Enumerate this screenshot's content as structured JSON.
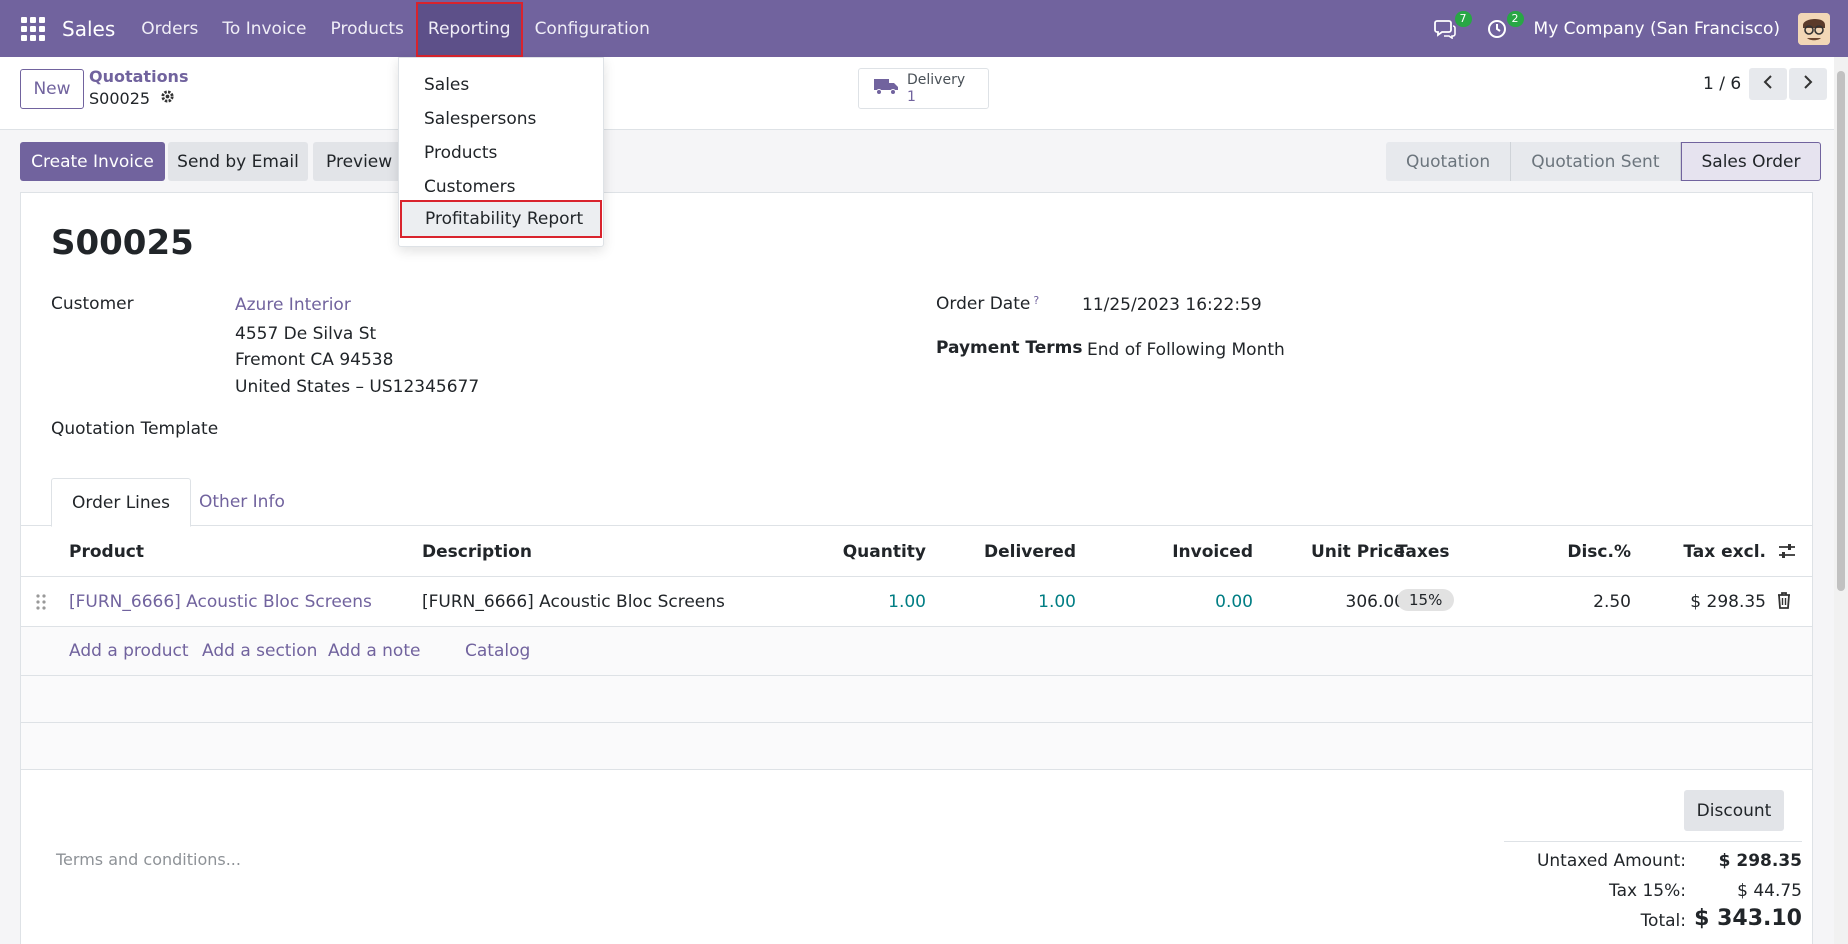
{
  "navbar": {
    "app_name": "Sales",
    "menu": [
      "Orders",
      "To Invoice",
      "Products",
      "Reporting",
      "Configuration"
    ],
    "messages_count": "7",
    "activities_count": "2",
    "company": "My Company (San Francisco)"
  },
  "reporting_menu": {
    "items": [
      "Sales",
      "Salespersons",
      "Products",
      "Customers",
      "Profitability Report"
    ]
  },
  "control_panel": {
    "new_label": "New",
    "breadcrumb_parent": "Quotations",
    "breadcrumb_current": "S00025",
    "delivery_label": "Delivery",
    "delivery_count": "1",
    "pager": "1 / 6"
  },
  "actions": {
    "create_invoice": "Create Invoice",
    "send_email": "Send by Email",
    "preview": "Preview"
  },
  "statusbar": {
    "stages": [
      "Quotation",
      "Quotation Sent",
      "Sales Order"
    ],
    "current": "Sales Order"
  },
  "form": {
    "title": "S00025",
    "customer_label": "Customer",
    "customer_name": "Azure Interior",
    "address_line1": "4557 De Silva St",
    "address_line2": "Fremont CA 94538",
    "address_line3": "United States – US12345677",
    "quotation_template_label": "Quotation Template",
    "order_date_label": "Order Date",
    "order_date_help": "?",
    "order_date": "11/25/2023 16:22:59",
    "payment_terms_label": "Payment Terms",
    "payment_terms": "End of Following Month"
  },
  "tabs": [
    "Order Lines",
    "Other Info"
  ],
  "order_lines": {
    "columns": [
      "Product",
      "Description",
      "Quantity",
      "Delivered",
      "Invoiced",
      "Unit Price",
      "Taxes",
      "Disc.%",
      "Tax excl."
    ],
    "rows": [
      {
        "product": "[FURN_6666] Acoustic Bloc Screens",
        "description": "[FURN_6666] Acoustic Bloc Screens",
        "quantity": "1.00",
        "delivered": "1.00",
        "invoiced": "0.00",
        "unit_price": "306.00",
        "taxes": "15%",
        "discount": "2.50",
        "subtotal": "$ 298.35"
      }
    ],
    "add_links": [
      "Add a product",
      "Add a section",
      "Add a note",
      "Catalog"
    ]
  },
  "footer": {
    "discount_button": "Discount",
    "terms_placeholder": "Terms and conditions...",
    "untaxed_label": "Untaxed Amount:",
    "untaxed_value": "$ 298.35",
    "tax_label": "Tax 15%:",
    "tax_value": "$ 44.75",
    "total_label": "Total:",
    "total_value": "$ 343.10"
  },
  "colors": {
    "brand": "#71639e",
    "highlight_border": "#d9232d",
    "badge": "#28a745",
    "numeric_link": "#017e84"
  }
}
